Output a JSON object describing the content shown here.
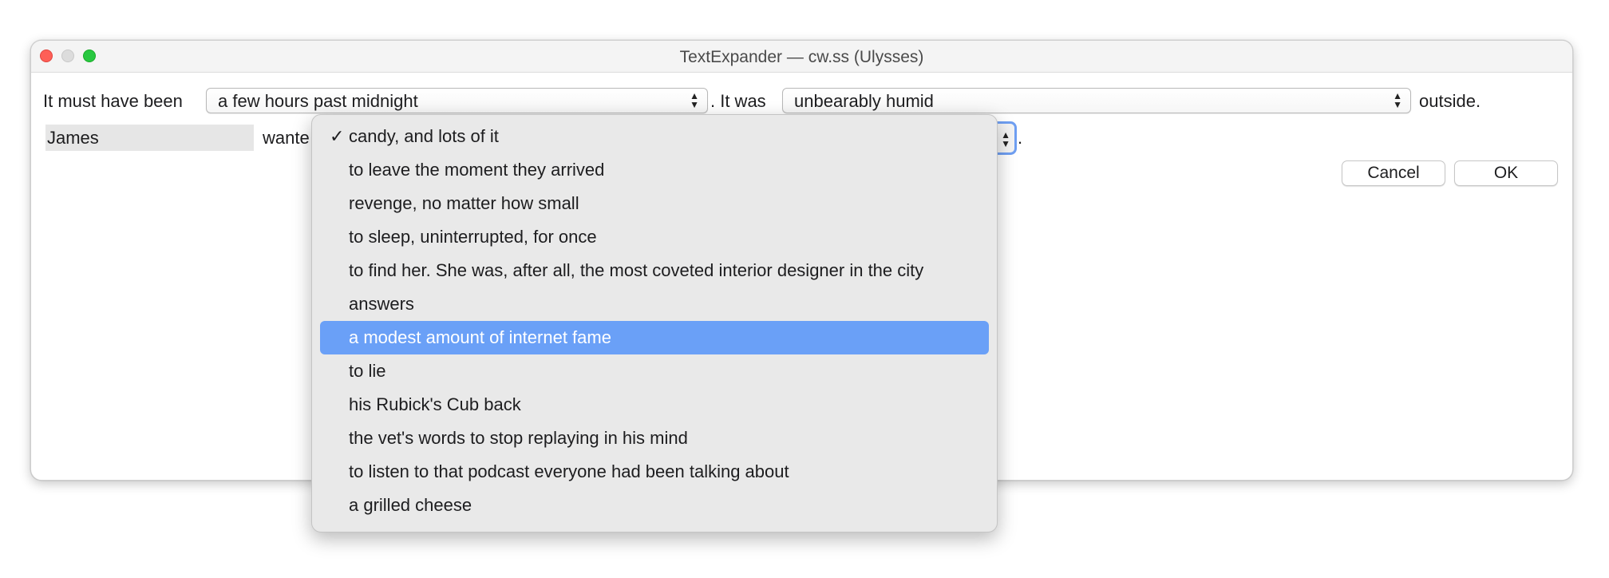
{
  "window": {
    "title": "TextExpander — cw.ss (Ulysses)"
  },
  "form": {
    "line1_prefix": "It must have been",
    "time_popup": "a few hours past midnight",
    "line1_mid": ". It was",
    "weather_popup": "unbearably humid",
    "line1_suffix": "outside.",
    "name_value": "James",
    "line2_prefix": "wante",
    "line2_suffix": "."
  },
  "buttons": {
    "cancel": "Cancel",
    "ok": "OK"
  },
  "menu": {
    "selected_index": 0,
    "highlighted_index": 6,
    "check_glyph": "✓",
    "items": [
      "candy, and lots of it",
      "to leave the moment they arrived",
      "revenge, no matter how small",
      "to sleep, uninterrupted, for once",
      "to find her. She was, after all, the most coveted interior designer in the city",
      "answers",
      "a modest amount of internet fame",
      "to lie",
      "his Rubick's Cub back",
      "the vet's words to stop replaying in his mind",
      "to listen to that podcast everyone had been talking about",
      "a grilled cheese"
    ]
  }
}
